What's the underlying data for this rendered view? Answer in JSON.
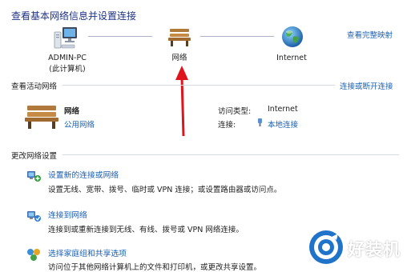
{
  "header": {
    "title": "查看基本网络信息并设置连接",
    "view_full_map": "查看完整映射"
  },
  "map_nodes": {
    "pc_name": "ADMIN-PC",
    "pc_sub": "(此计算机)",
    "network": "网络",
    "internet": "Internet"
  },
  "active": {
    "section_label": "查看活动网络",
    "connect_disconnect": "连接或断开连接",
    "network_name": "网络",
    "network_type": "公用网络",
    "access_type_label": "访问类型:",
    "access_type_value": "Internet",
    "connections_label": "连接:",
    "connections_value": "本地连接"
  },
  "change": {
    "section_label": "更改网络设置",
    "items": [
      {
        "title": "设置新的连接或网络",
        "desc": "设置无线、宽带、拨号、临时或 VPN 连接；或设置路由器或访问点。"
      },
      {
        "title": "连接到网络",
        "desc": "连接到或重新连接到无线、有线、拨号或 VPN 网络连接。"
      },
      {
        "title": "选择家庭组和共享选项",
        "desc": "访问位于其他网络计算机上的文件和打印机，或更改共享设置。"
      }
    ]
  },
  "watermark": {
    "text": "好装机"
  },
  "colors": {
    "annotation_arrow": "#e0141c",
    "link": "#1a5fb4",
    "title": "#1e3287"
  }
}
